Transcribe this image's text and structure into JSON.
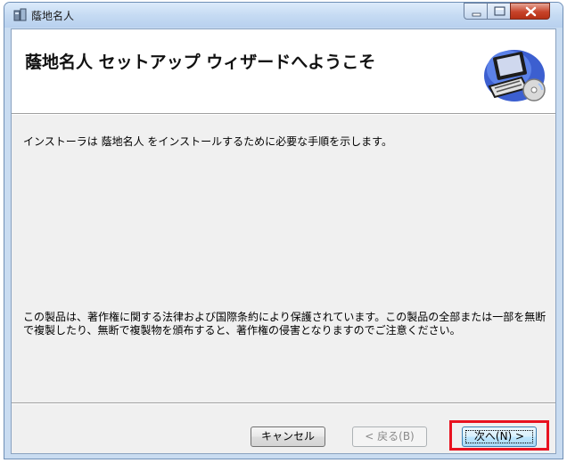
{
  "window": {
    "title": "蔭地名人"
  },
  "header": {
    "title": "蔭地名人 セットアップ ウィザードへようこそ"
  },
  "body": {
    "intro": "インストーラは 蔭地名人 をインストールするために必要な手順を示します。",
    "legal": "この製品は、著作権に関する法律および国際条約により保護されています。この製品の全部または一部を無断で複製したり、無断で複製物を頒布すると、著作権の侵害となりますのでご注意ください。"
  },
  "buttons": {
    "cancel": "キャンセル",
    "back": "< 戻る(B)",
    "next": "次へ(N) >"
  },
  "icons": {
    "app": "installer-icon",
    "logo": "computer-cd-icon"
  },
  "colors": {
    "highlight": "#e8121f",
    "header_bg": "#ffffff",
    "client_bg": "#f0f0f0"
  }
}
